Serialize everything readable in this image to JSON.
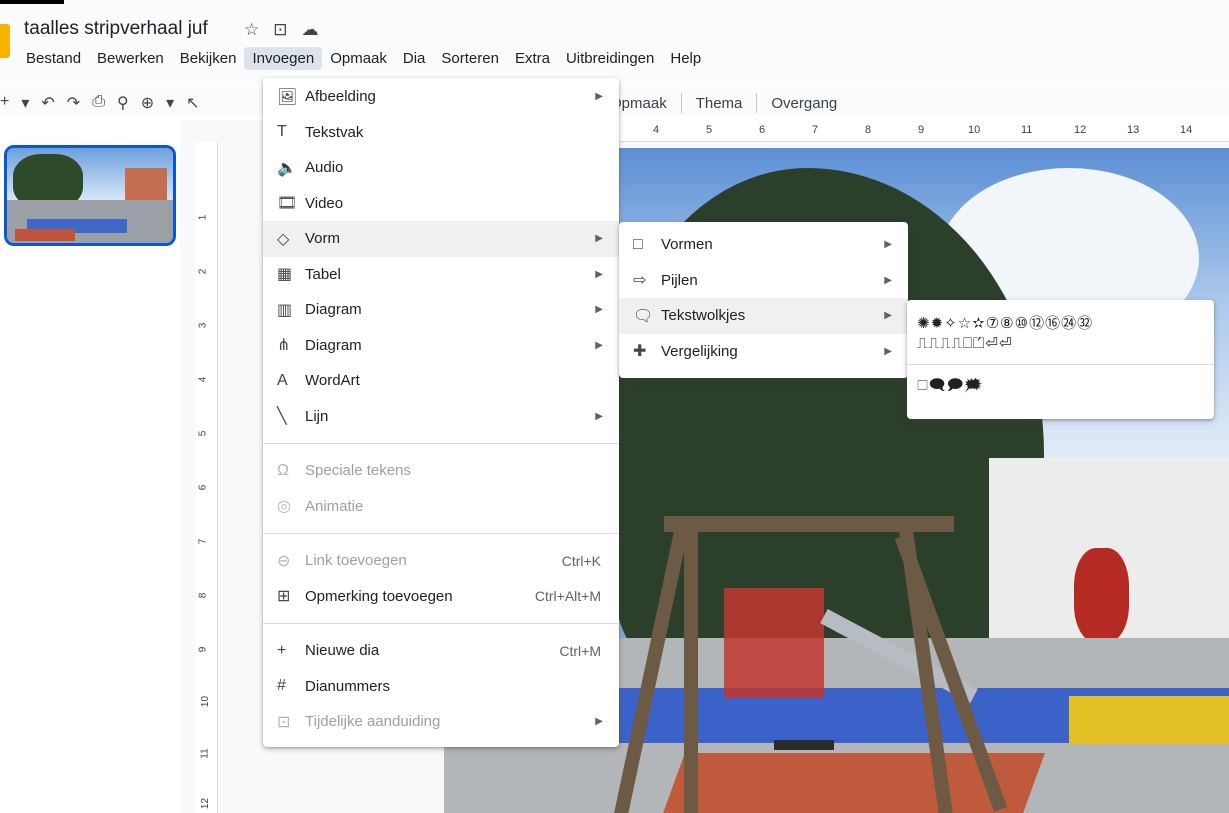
{
  "header": {
    "title": "taalles stripverhaal juf",
    "menus": [
      "Bestand",
      "Bewerken",
      "Bekijken",
      "Invoegen",
      "Opmaak",
      "Dia",
      "Sorteren",
      "Extra",
      "Uitbreidingen",
      "Help"
    ]
  },
  "toolbar": {
    "right": [
      "Opmaak",
      "Thema",
      "Overgang"
    ]
  },
  "ruler": {
    "top": [
      "4",
      "5",
      "6",
      "7",
      "8",
      "9",
      "10",
      "11",
      "12",
      "13",
      "14"
    ],
    "left": [
      "1",
      "2",
      "3",
      "4",
      "5",
      "6",
      "7",
      "8",
      "9",
      "10",
      "11",
      "12"
    ]
  },
  "insert_menu": {
    "items": [
      {
        "icon": "image-icon",
        "glyph": "🖼",
        "label": "Afbeelding",
        "submenu": true
      },
      {
        "icon": "textbox-icon",
        "glyph": "T",
        "label": "Tekstvak"
      },
      {
        "icon": "audio-icon",
        "glyph": "🔈",
        "label": "Audio"
      },
      {
        "icon": "video-icon",
        "glyph": "🎞",
        "label": "Video"
      },
      {
        "icon": "shape-icon",
        "glyph": "◇",
        "label": "Vorm",
        "submenu": true,
        "highlighted": true
      },
      {
        "icon": "table-icon",
        "glyph": "▦",
        "label": "Tabel",
        "submenu": true
      },
      {
        "icon": "chart-icon",
        "glyph": "▥",
        "label": "Diagram",
        "submenu": true
      },
      {
        "icon": "diagram-icon",
        "glyph": "⋔",
        "label": "Diagram",
        "submenu": true
      },
      {
        "icon": "wordart-icon",
        "glyph": "A",
        "label": "WordArt"
      },
      {
        "icon": "line-icon",
        "glyph": "╲",
        "label": "Lijn",
        "submenu": true
      }
    ],
    "items2": [
      {
        "icon": "omega-icon",
        "glyph": "Ω",
        "label": "Speciale tekens",
        "disabled": true
      },
      {
        "icon": "animation-icon",
        "glyph": "◎",
        "label": "Animatie",
        "disabled": true
      }
    ],
    "items3": [
      {
        "icon": "link-icon",
        "glyph": "⊖",
        "label": "Link toevoegen",
        "shortcut": "Ctrl+K",
        "disabled": true
      },
      {
        "icon": "comment-icon",
        "glyph": "⊞",
        "label": "Opmerking toevoegen",
        "shortcut": "Ctrl+Alt+M"
      }
    ],
    "items4": [
      {
        "icon": "plus-icon",
        "glyph": "+",
        "label": "Nieuwe dia",
        "shortcut": "Ctrl+M"
      },
      {
        "icon": "hash-icon",
        "glyph": "#",
        "label": "Dianummers"
      },
      {
        "icon": "placeholder-icon",
        "glyph": "⊡",
        "label": "Tijdelijke aanduiding",
        "submenu": true,
        "disabled": true
      }
    ]
  },
  "shape_menu": {
    "items": [
      {
        "icon": "square-icon",
        "glyph": "□",
        "label": "Vormen"
      },
      {
        "icon": "arrow-icon",
        "glyph": "⇨",
        "label": "Pijlen"
      },
      {
        "icon": "callout-icon",
        "glyph": "🗨",
        "label": "Tekstwolkjes",
        "highlighted": true
      },
      {
        "icon": "equation-icon",
        "glyph": "✚",
        "label": "Vergelijking"
      }
    ]
  },
  "callouts_panel": {
    "row1": "✺✹✧☆✫⑦⑧⑩⑫⑯㉔㉜",
    "row2": "⎍⎍⎍⎍⎕⏍⏎⏎",
    "row3": "🗆🗨🗩🗯"
  }
}
